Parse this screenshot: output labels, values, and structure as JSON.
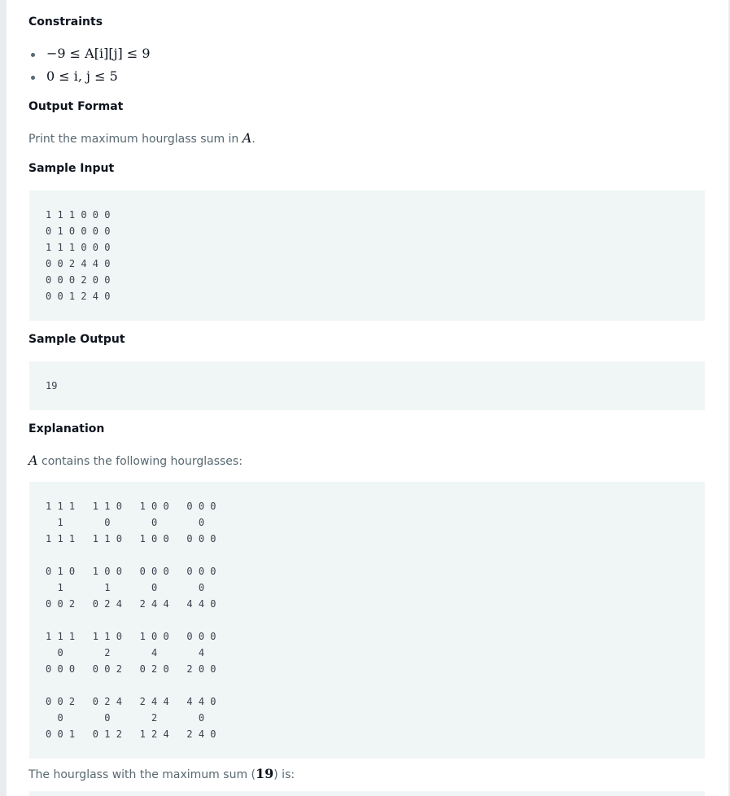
{
  "constraints": {
    "heading": "Constraints",
    "items": [
      "−9 ≤ A[i][j] ≤ 9",
      "0 ≤ i, j ≤ 5"
    ]
  },
  "output_format": {
    "heading": "Output Format",
    "text_before": "Print the maximum hourglass sum in ",
    "math": "A",
    "text_after": "."
  },
  "sample_input": {
    "heading": "Sample Input",
    "lines": [
      "1 1 1 0 0 0",
      "0 1 0 0 0 0",
      "1 1 1 0 0 0",
      "0 0 2 4 4 0",
      "0 0 0 2 0 0",
      "0 0 1 2 4 0"
    ]
  },
  "sample_output": {
    "heading": "Sample Output",
    "value": "19"
  },
  "explanation": {
    "heading": "Explanation",
    "math": "A",
    "text": " contains the following hourglasses:",
    "hourglass_rows": [
      [
        "1 1 1   1 1 0   1 0 0   0 0 0",
        "  1       0       0       0",
        "1 1 1   1 1 0   1 0 0   0 0 0"
      ],
      [
        "0 1 0   1 0 0   0 0 0   0 0 0",
        "  1       1       0       0",
        "0 0 2   0 2 4   2 4 4   4 4 0"
      ],
      [
        "1 1 1   1 1 0   1 0 0   0 0 0",
        "  0       2       4       4",
        "0 0 0   0 0 2   0 2 0   2 0 0"
      ],
      [
        "0 0 2   0 2 4   2 4 4   4 4 0",
        "  0       0       2       0",
        "0 0 1   0 1 2   1 2 4   2 4 0"
      ]
    ],
    "max_text_before": "The hourglass with the maximum sum (",
    "max_value": "19",
    "max_text_after": ") is:"
  }
}
